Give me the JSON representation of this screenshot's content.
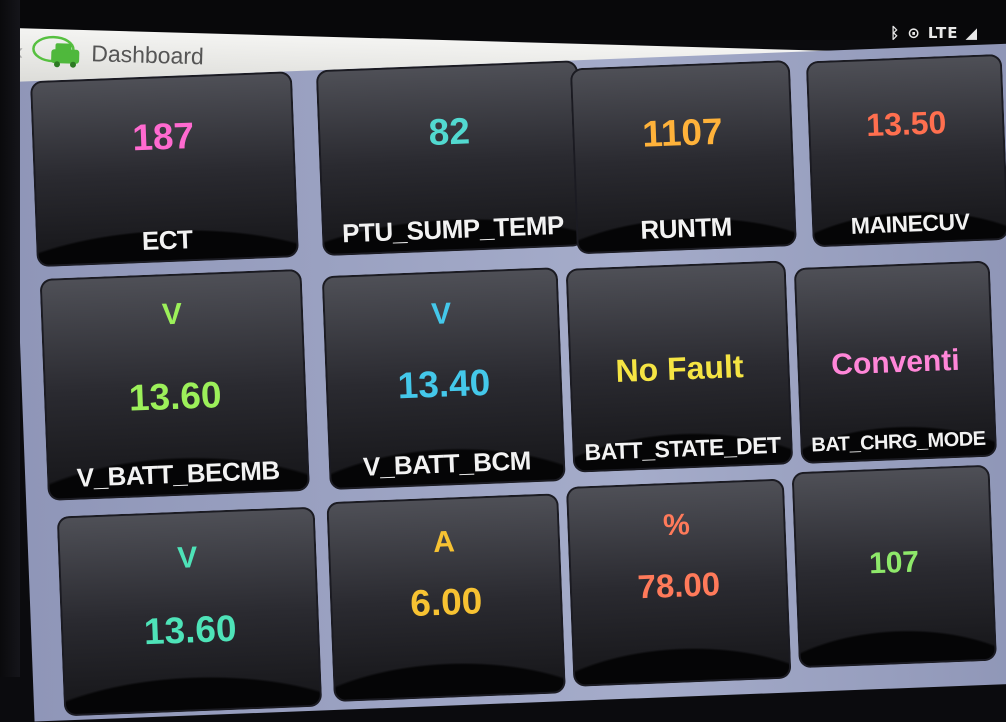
{
  "statusbar": {
    "bluetooth_icon": "bluetooth-icon",
    "location_icon": "location-icon",
    "network": "LTE",
    "signal_icon": "signal-icon"
  },
  "header": {
    "title": "Dashboard",
    "logo_icon": "car-logo-icon",
    "actions": [
      "square-button",
      "search-icon",
      "search-icon"
    ]
  },
  "colors": {
    "pink": "#ff6ad0",
    "cyan": "#52d9d0",
    "orange": "#ffb23a",
    "coral": "#ff6f4f",
    "green": "#9cf05a",
    "blue": "#44c8ea",
    "yellow": "#f5e443",
    "magenta": "#ff86d8",
    "teal": "#4ee3b8",
    "gold": "#f7c232",
    "salmon": "#ff7a5a",
    "lime": "#8ee86a"
  },
  "tiles": [
    {
      "unit": "",
      "value": "187",
      "label": "ECT",
      "color": "#ff6ad0"
    },
    {
      "unit": "",
      "value": "82",
      "label": "PTU_SUMP_TEMP",
      "color": "#52d9d0"
    },
    {
      "unit": "",
      "value": "1107",
      "label": "RUNTM",
      "color": "#ffb23a"
    },
    {
      "unit": "",
      "value": "13.50",
      "label": "MAINECUV",
      "color": "#ff6f4f"
    },
    {
      "unit": "V",
      "value": "13.60",
      "label": "V_BATT_BECMB",
      "color": "#9cf05a"
    },
    {
      "unit": "V",
      "value": "13.40",
      "label": "V_BATT_BCM",
      "color": "#44c8ea"
    },
    {
      "unit": "",
      "value": "No Fault",
      "label": "BATT_STATE_DET",
      "color": "#f5e443"
    },
    {
      "unit": "",
      "value": "Conventi",
      "label": "BAT_CHRG_MODE",
      "color": "#ff86d8"
    },
    {
      "unit": "V",
      "value": "13.60",
      "label": "",
      "color": "#4ee3b8"
    },
    {
      "unit": "A",
      "value": "6.00",
      "label": "",
      "color": "#f7c232"
    },
    {
      "unit": "%",
      "value": "78.00",
      "label": "",
      "color": "#ff7a5a"
    },
    {
      "unit": "",
      "value": "107",
      "label": "",
      "color": "#8ee86a"
    }
  ]
}
